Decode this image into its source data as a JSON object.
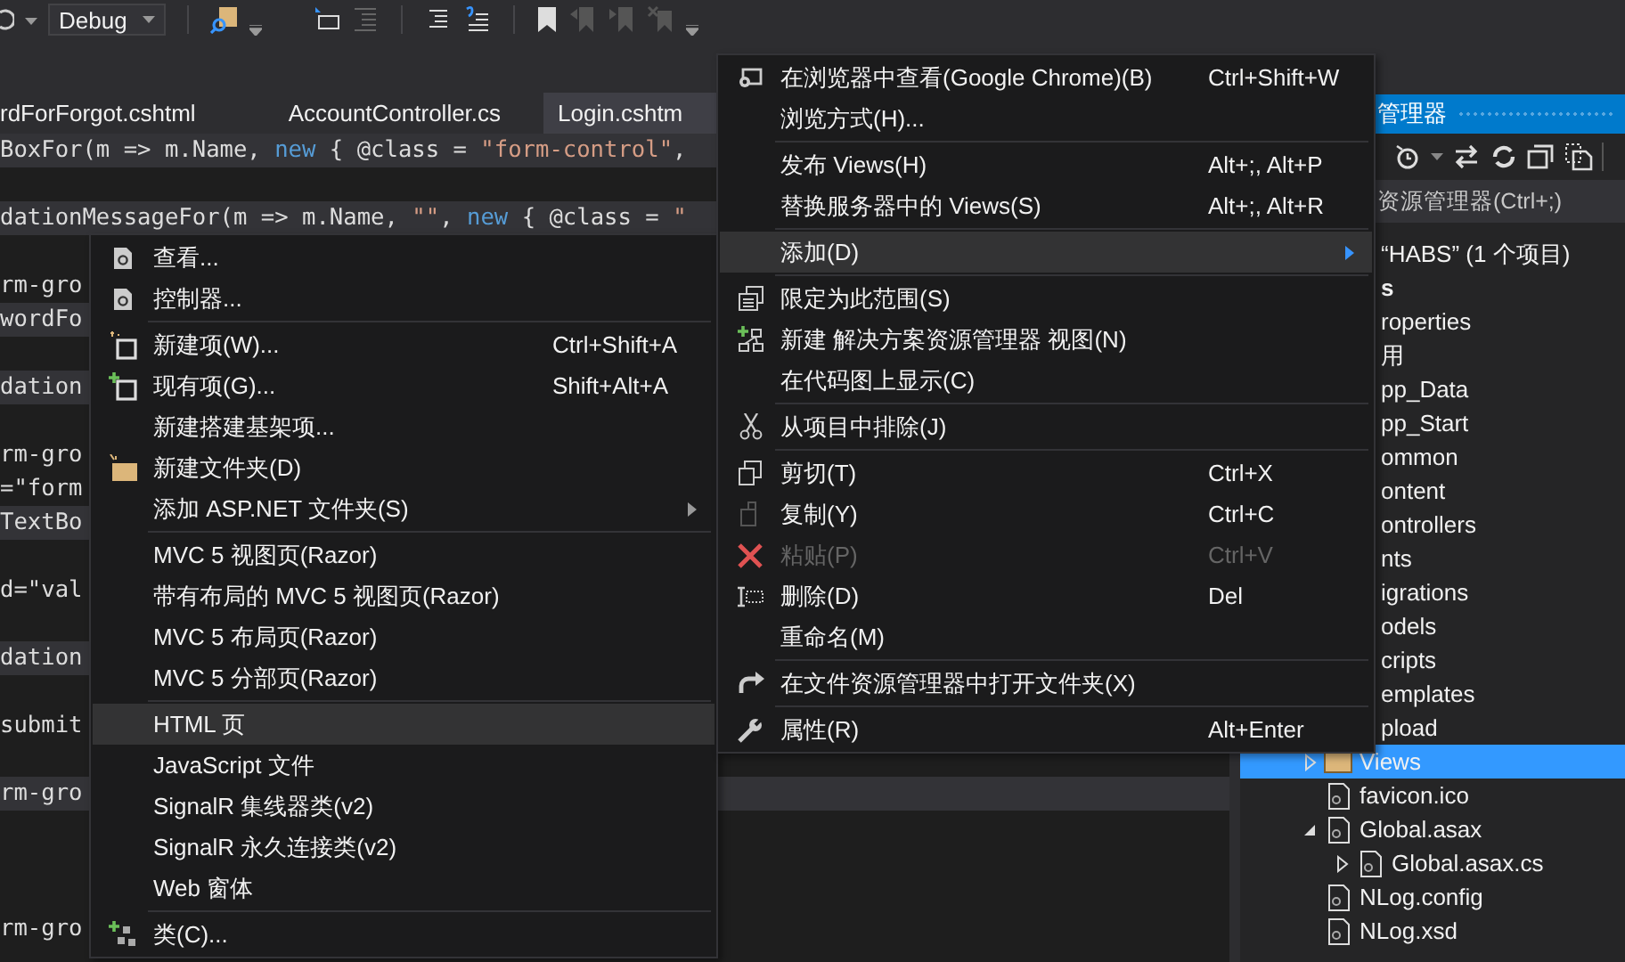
{
  "toolbar": {
    "configuration": "Debug"
  },
  "document_tabs": [
    {
      "label": "rdForForgot.cshtml",
      "selected": false
    },
    {
      "label": "AccountController.cs",
      "selected": false
    },
    {
      "label": "Login.cshtm",
      "selected": true
    }
  ],
  "code_lines": [
    {
      "highlighted": true,
      "tokens": [
        {
          "text": "BoxFor(m => m.Name, ",
          "kind": "plain"
        },
        {
          "text": "new",
          "kind": "keyword"
        },
        {
          "text": " { @class = ",
          "kind": "plain"
        },
        {
          "text": "\"form-control\"",
          "kind": "string"
        },
        {
          "text": ",",
          "kind": "plain"
        }
      ]
    },
    {
      "highlighted": false
    },
    {
      "highlighted": true,
      "tokens": [
        {
          "text": "dationMessageFor(m => m.Name, ",
          "kind": "plain"
        },
        {
          "text": "\"\"",
          "kind": "string"
        },
        {
          "text": ", ",
          "kind": "plain"
        },
        {
          "text": "new",
          "kind": "keyword"
        },
        {
          "text": " { @class = ",
          "kind": "plain"
        },
        {
          "text": "\"",
          "kind": "string"
        }
      ]
    },
    {
      "highlighted": false
    },
    {
      "highlighted": false,
      "tokens": [
        {
          "text": "rm-gro",
          "kind": "plain"
        }
      ]
    },
    {
      "highlighted": true,
      "tokens": [
        {
          "text": "wordFo",
          "kind": "plain"
        }
      ]
    },
    {
      "highlighted": false
    },
    {
      "highlighted": true,
      "tokens": [
        {
          "text": "dation",
          "kind": "plain"
        }
      ]
    },
    {
      "highlighted": false
    },
    {
      "highlighted": false,
      "tokens": [
        {
          "text": "rm-gro",
          "kind": "plain"
        }
      ]
    },
    {
      "highlighted": false,
      "tokens": [
        {
          "text": "=\"form",
          "kind": "plain"
        }
      ]
    },
    {
      "highlighted": true,
      "tokens": [
        {
          "text": "TextBo",
          "kind": "plain"
        }
      ]
    },
    {
      "highlighted": false
    },
    {
      "highlighted": false,
      "tokens": [
        {
          "text": "d=\"val",
          "kind": "plain"
        }
      ]
    },
    {
      "highlighted": false
    },
    {
      "highlighted": true,
      "tokens": [
        {
          "text": "dation",
          "kind": "plain"
        }
      ]
    },
    {
      "highlighted": false
    },
    {
      "highlighted": false,
      "tokens": [
        {
          "text": "submit",
          "kind": "plain"
        }
      ]
    },
    {
      "highlighted": false
    },
    {
      "highlighted": true,
      "tokens": [
        {
          "text": "rm-gro",
          "kind": "plain"
        }
      ]
    },
    {
      "highlighted": false
    },
    {
      "highlighted": false
    },
    {
      "highlighted": false
    },
    {
      "highlighted": false,
      "tokens": [
        {
          "text": "rm-gro",
          "kind": "plain"
        }
      ]
    }
  ],
  "solution_explorer": {
    "title": "管理器",
    "search": {
      "placeholder": "资源管理器(Ctrl+;)"
    },
    "tree": [
      {
        "label": "“HABS” (1 个项目)",
        "partly_hidden": true,
        "selected": false,
        "children": [
          {
            "label": "s",
            "kind": "project",
            "partly_hidden": true,
            "selected": false,
            "children": [
              {
                "label": "roperties",
                "partly_hidden": true,
                "selected": false
              },
              {
                "label": "用",
                "partly_hidden": true,
                "selected": false
              },
              {
                "label": "pp_Data",
                "partly_hidden": true,
                "selected": false
              },
              {
                "label": "pp_Start",
                "partly_hidden": true,
                "selected": false
              },
              {
                "label": "ommon",
                "partly_hidden": true,
                "selected": false
              },
              {
                "label": "ontent",
                "partly_hidden": true,
                "selected": false
              },
              {
                "label": "ontrollers",
                "partly_hidden": true,
                "selected": false
              },
              {
                "label": "nts",
                "partly_hidden": true,
                "selected": false
              },
              {
                "label": "igrations",
                "partly_hidden": true,
                "selected": false
              },
              {
                "label": "odels",
                "partly_hidden": true,
                "selected": false
              },
              {
                "label": "cripts",
                "partly_hidden": true,
                "selected": false
              },
              {
                "label": "emplates",
                "partly_hidden": true,
                "selected": false
              },
              {
                "label": "pload",
                "partly_hidden": true,
                "selected": false
              },
              {
                "label": "Views",
                "kind": "folder",
                "partly_hidden": false,
                "selected": true,
                "expanded": false
              },
              {
                "label": "favicon.ico",
                "kind": "file",
                "partly_hidden": false,
                "selected": false
              },
              {
                "label": "Global.asax",
                "kind": "file",
                "partly_hidden": false,
                "selected": false,
                "expanded": true,
                "children": [
                  {
                    "label": "Global.asax.cs",
                    "kind": "file",
                    "partly_hidden": false,
                    "selected": false,
                    "expanded": false
                  }
                ]
              },
              {
                "label": "NLog.config",
                "kind": "file",
                "partly_hidden": false,
                "selected": false
              },
              {
                "label": "NLog.xsd",
                "kind": "file",
                "partly_hidden": false,
                "selected": false
              }
            ]
          }
        ]
      }
    ]
  },
  "context_menu": [
    [
      {
        "label": "在浏览器中查看(Google Chrome)(B)",
        "shortcut": "Ctrl+Shift+W",
        "selected": false,
        "disabled": false,
        "submenu": false
      },
      {
        "label": "浏览方式(H)...",
        "selected": false,
        "disabled": false,
        "submenu": false
      }
    ],
    [
      {
        "label": "发布 Views(H)",
        "shortcut": "Alt+;, Alt+P",
        "selected": false,
        "disabled": false,
        "submenu": false
      },
      {
        "label": "替换服务器中的 Views(S)",
        "shortcut": "Alt+;, Alt+R",
        "selected": false,
        "disabled": false,
        "submenu": false
      }
    ],
    [
      {
        "label": "添加(D)",
        "selected": true,
        "disabled": false,
        "submenu": true
      }
    ],
    [
      {
        "label": "限定为此范围(S)",
        "selected": false,
        "disabled": false,
        "submenu": false
      },
      {
        "label": "新建 解决方案资源管理器 视图(N)",
        "selected": false,
        "disabled": false,
        "submenu": false
      },
      {
        "label": "在代码图上显示(C)",
        "selected": false,
        "disabled": false,
        "submenu": false
      }
    ],
    [
      {
        "label": "从项目中排除(J)",
        "selected": false,
        "disabled": false,
        "submenu": false
      }
    ],
    [
      {
        "label": "剪切(T)",
        "shortcut": "Ctrl+X",
        "selected": false,
        "disabled": false,
        "submenu": false
      },
      {
        "label": "复制(Y)",
        "shortcut": "Ctrl+C",
        "selected": false,
        "disabled": false,
        "submenu": false
      },
      {
        "label": "粘贴(P)",
        "shortcut": "Ctrl+V",
        "selected": false,
        "disabled": true,
        "submenu": false
      },
      {
        "label": "删除(D)",
        "shortcut": "Del",
        "selected": false,
        "disabled": false,
        "submenu": false
      },
      {
        "label": "重命名(M)",
        "selected": false,
        "disabled": false,
        "submenu": false
      }
    ],
    [
      {
        "label": "在文件资源管理器中打开文件夹(X)",
        "selected": false,
        "disabled": false,
        "submenu": false
      }
    ],
    [
      {
        "label": "属性(R)",
        "shortcut": "Alt+Enter",
        "selected": false,
        "disabled": false,
        "submenu": false
      }
    ]
  ],
  "add_submenu": [
    [
      {
        "label": "查看...",
        "selected": false,
        "disabled": false,
        "submenu": false
      },
      {
        "label": "控制器...",
        "selected": false,
        "disabled": false,
        "submenu": false
      }
    ],
    [
      {
        "label": "新建项(W)...",
        "shortcut": "Ctrl+Shift+A",
        "selected": false,
        "disabled": false,
        "submenu": false
      },
      {
        "label": "现有项(G)...",
        "shortcut": "Shift+Alt+A",
        "selected": false,
        "disabled": false,
        "submenu": false
      },
      {
        "label": "新建搭建基架项...",
        "selected": false,
        "disabled": false,
        "submenu": false
      },
      {
        "label": "新建文件夹(D)",
        "selected": false,
        "disabled": false,
        "submenu": false
      },
      {
        "label": "添加 ASP.NET 文件夹(S)",
        "selected": false,
        "disabled": false,
        "submenu": true
      }
    ],
    [
      {
        "label": "MVC 5 视图页(Razor)",
        "selected": false,
        "disabled": false,
        "submenu": false
      },
      {
        "label": "带有布局的 MVC 5 视图页(Razor)",
        "selected": false,
        "disabled": false,
        "submenu": false
      },
      {
        "label": "MVC 5 布局页(Razor)",
        "selected": false,
        "disabled": false,
        "submenu": false
      },
      {
        "label": "MVC 5 分部页(Razor)",
        "selected": false,
        "disabled": false,
        "submenu": false
      }
    ],
    [
      {
        "label": "HTML 页",
        "selected": true,
        "disabled": false,
        "submenu": false
      },
      {
        "label": "JavaScript 文件",
        "selected": false,
        "disabled": false,
        "submenu": false
      },
      {
        "label": "SignalR 集线器类(v2)",
        "selected": false,
        "disabled": false,
        "submenu": false
      },
      {
        "label": "SignalR 永久连接类(v2)",
        "selected": false,
        "disabled": false,
        "submenu": false
      },
      {
        "label": "Web 窗体",
        "selected": false,
        "disabled": false,
        "submenu": false
      }
    ],
    [
      {
        "label": "类(C)...",
        "selected": false,
        "disabled": false,
        "submenu": false
      }
    ]
  ]
}
